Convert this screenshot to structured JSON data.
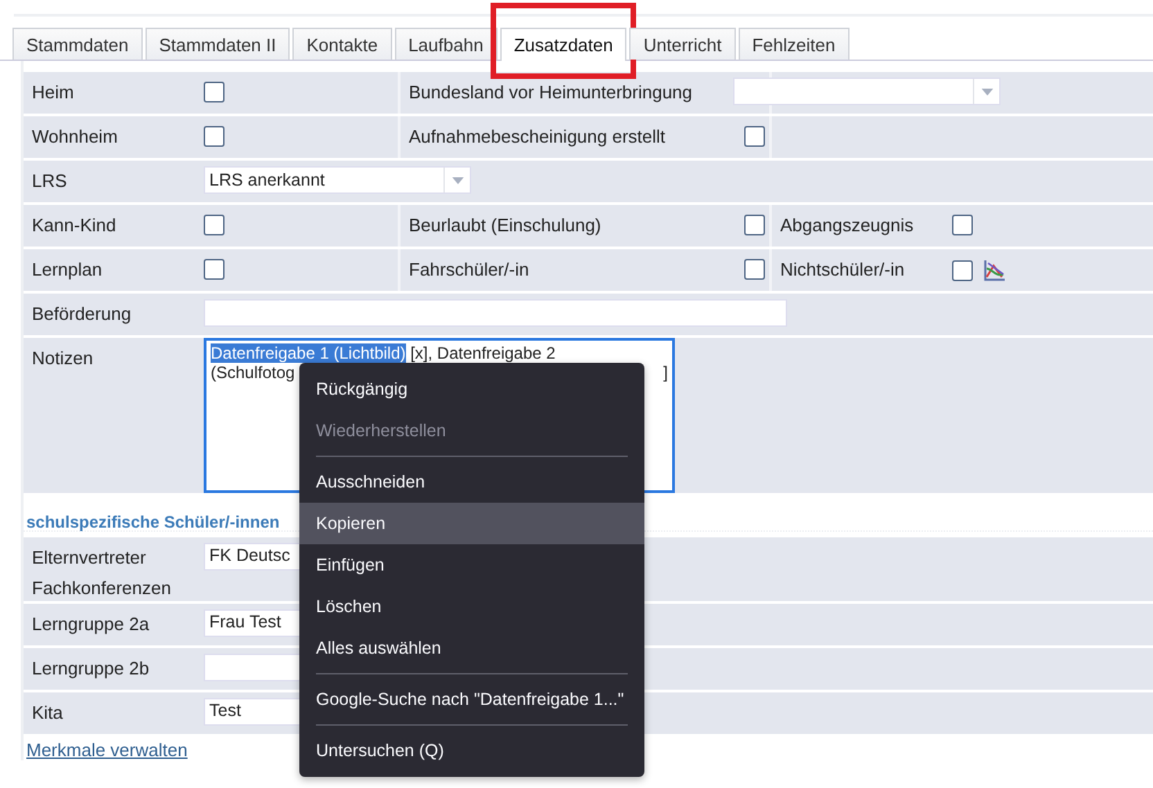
{
  "tabs": [
    {
      "label": "Stammdaten",
      "selected": false,
      "highlighted": false
    },
    {
      "label": "Stammdaten II",
      "selected": false,
      "highlighted": false
    },
    {
      "label": "Kontakte",
      "selected": false,
      "highlighted": false
    },
    {
      "label": "Laufbahn",
      "selected": false,
      "highlighted": false
    },
    {
      "label": "Zusatzdaten",
      "selected": true,
      "highlighted": true
    },
    {
      "label": "Unterricht",
      "selected": false,
      "highlighted": false
    },
    {
      "label": "Fehlzeiten",
      "selected": false,
      "highlighted": false
    }
  ],
  "form": {
    "rows": [
      {
        "fields": [
          {
            "label": "Heim",
            "kind": "checkbox",
            "checked": false
          },
          {
            "label": "Bundesland vor Heimunterbringung",
            "kind": "select"
          }
        ]
      },
      {
        "fields": [
          {
            "label": "Wohnheim",
            "kind": "checkbox",
            "checked": false
          },
          {
            "label": "Aufnahmebescheinigung erstellt",
            "kind": "checkbox",
            "checked": false
          }
        ]
      },
      {
        "fields": [
          {
            "label": "LRS",
            "kind": "select",
            "value": "LRS anerkannt"
          }
        ]
      },
      {
        "fields": [
          {
            "label": "Kann-Kind",
            "kind": "checkbox",
            "checked": false
          },
          {
            "label": "Beurlaubt (Einschulung)",
            "kind": "checkbox",
            "checked": false
          },
          {
            "label": "Abgangszeugnis",
            "kind": "checkbox",
            "checked": false
          }
        ]
      },
      {
        "fields": [
          {
            "label": "Lernplan",
            "kind": "checkbox",
            "checked": false
          },
          {
            "label": "Fahrschüler/-in",
            "kind": "checkbox",
            "checked": false
          },
          {
            "label": "Nichtschüler/-in",
            "kind": "checkbox-icon",
            "checked": false
          }
        ]
      },
      {
        "fields": [
          {
            "label": "Beförderung",
            "kind": "text"
          }
        ]
      },
      {
        "fields": [
          {
            "label": "Notizen",
            "kind": "notes",
            "selected_text": "Datenfreigabe 1 (Lichtbild)",
            "text": " [x], Datenfreigabe 2",
            "line_2": "(Schulfotog",
            "line_2_end": "]"
          }
        ]
      }
    ]
  },
  "section": {
    "heading": "schulspezifische Schüler/-innen",
    "rows": [
      {
        "label": "Elternvertreter Fachkonferenzen",
        "value": "FK Deutsc"
      },
      {
        "label": "Lerngruppe 2a",
        "value": "Frau Test"
      },
      {
        "label": "Lerngruppe 2b"
      },
      {
        "label": "Kita",
        "value": "Test"
      }
    ],
    "link": "Merkmale verwalten"
  },
  "context_menu": {
    "items": [
      {
        "kind": "item",
        "label": "Rückgängig",
        "disabled": false,
        "hovered": false
      },
      {
        "kind": "item",
        "label": "Wiederherstellen",
        "disabled": true,
        "hovered": false
      },
      {
        "kind": "separator"
      },
      {
        "kind": "item",
        "label": "Ausschneiden",
        "disabled": false,
        "hovered": false
      },
      {
        "kind": "item",
        "label": "Kopieren",
        "disabled": false,
        "hovered": true
      },
      {
        "kind": "item",
        "label": "Einfügen",
        "disabled": false,
        "hovered": false
      },
      {
        "kind": "item",
        "label": "Löschen",
        "disabled": false,
        "hovered": false
      },
      {
        "kind": "item",
        "label": "Alles auswählen",
        "disabled": false,
        "hovered": false
      },
      {
        "kind": "separator"
      },
      {
        "kind": "item",
        "label": "Google-Suche nach \"Datenfreigabe 1...\"",
        "disabled": false,
        "hovered": false
      },
      {
        "kind": "separator"
      },
      {
        "kind": "item",
        "label": "Untersuchen (Q)",
        "disabled": false,
        "hovered": false
      }
    ]
  }
}
